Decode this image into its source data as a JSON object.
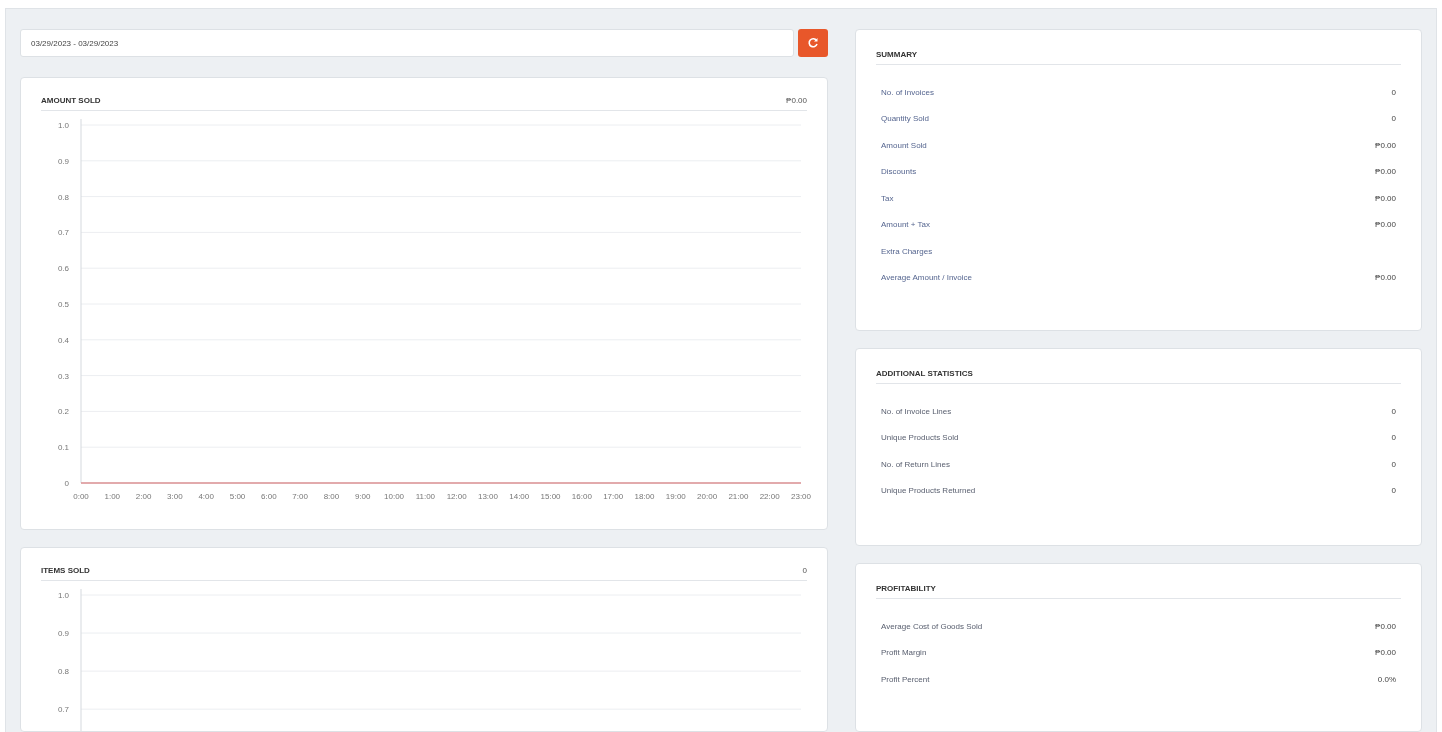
{
  "date_range": {
    "value": "03/29/2023 - 03/29/2023"
  },
  "charts": [
    {
      "title": "AMOUNT SOLD",
      "total": "₱0.00",
      "chart_data": {
        "type": "line",
        "categories": [
          "0:00",
          "1:00",
          "2:00",
          "3:00",
          "4:00",
          "5:00",
          "6:00",
          "7:00",
          "8:00",
          "9:00",
          "10:00",
          "11:00",
          "12:00",
          "13:00",
          "14:00",
          "15:00",
          "16:00",
          "17:00",
          "18:00",
          "19:00",
          "20:00",
          "21:00",
          "22:00",
          "23:00"
        ],
        "ylim": [
          0,
          1
        ],
        "yticks": [
          {
            "value": 1,
            "label": "1.0"
          },
          {
            "value": 0.9,
            "label": "0.9"
          },
          {
            "value": 0.8,
            "label": "0.8"
          },
          {
            "value": 0.7,
            "label": "0.7"
          },
          {
            "value": 0.6,
            "label": "0.6"
          },
          {
            "value": 0.5,
            "label": "0.5"
          },
          {
            "value": 0.4,
            "label": "0.4"
          },
          {
            "value": 0.3,
            "label": "0.3"
          },
          {
            "value": 0.2,
            "label": "0.2"
          },
          {
            "value": 0.1,
            "label": "0.1"
          },
          {
            "value": 0,
            "label": "0"
          }
        ],
        "grid": true,
        "series": [
          {
            "color": "#e57373",
            "values": [
              0,
              0,
              0,
              0,
              0,
              0,
              0,
              0,
              0,
              0,
              0,
              0,
              0,
              0,
              0,
              0,
              0,
              0,
              0,
              0,
              0,
              0,
              0,
              0
            ]
          }
        ]
      }
    },
    {
      "title": "ITEMS SOLD",
      "total": "0",
      "chart_data": {
        "type": "line",
        "grid": true,
        "categories": [
          null,
          null,
          null,
          null,
          null,
          null,
          null,
          null,
          null,
          null,
          null,
          null,
          null,
          null,
          null,
          null,
          null,
          null,
          null,
          null,
          null,
          null,
          null,
          null
        ],
        "ylim": [
          0.64,
          1
        ],
        "yticks": [
          {
            "value": 1,
            "label": "1.0"
          },
          {
            "value": 0.9,
            "label": "0.9"
          },
          {
            "value": 0.8,
            "label": "0.8"
          },
          {
            "value": 0.7,
            "label": "0.7"
          }
        ]
      }
    }
  ],
  "panels": [
    {
      "title": "SUMMARY",
      "rows": [
        {
          "label": "No. of Invoices",
          "value": "0"
        },
        {
          "label": "Quantity Sold",
          "value": "0"
        },
        {
          "label": "Amount Sold",
          "value": "₱0.00"
        },
        {
          "label": "Discounts",
          "value": "₱0.00"
        },
        {
          "label": "Tax",
          "value": "₱0.00"
        },
        {
          "label": "Amount + Tax",
          "value": "₱0.00"
        },
        {
          "label": "Extra Charges"
        },
        {
          "label": "Average Amount / Invoice",
          "value": "₱0.00"
        }
      ]
    },
    {
      "title": "ADDITIONAL STATISTICS",
      "rows": [
        {
          "label": "No. of Invoice Lines",
          "value": "0"
        },
        {
          "label": "Unique Products Sold",
          "value": "0"
        },
        {
          "label": "No. of Return Lines",
          "value": "0"
        },
        {
          "label": "Unique Products Returned",
          "value": "0"
        }
      ]
    },
    {
      "title": "PROFITABILITY",
      "rows": [
        {
          "label": "Average Cost of Goods Sold",
          "value": "₱0.00"
        },
        {
          "label": "Profit Margin",
          "value": "₱0.00"
        },
        {
          "label": "Profit Percent",
          "value": "0.0%"
        }
      ]
    }
  ]
}
